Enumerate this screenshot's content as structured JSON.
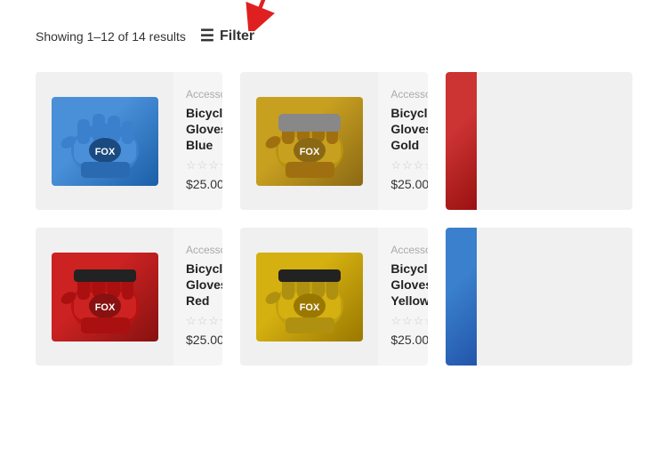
{
  "toolbar": {
    "showing_text": "Showing 1–12 of 14 results",
    "filter_label": "Filter",
    "filter_icon": "☰"
  },
  "products": [
    {
      "id": "p1",
      "category": "Accessories",
      "name": "Bicycle Gloves Blue",
      "price": "$25.00",
      "rating": 0,
      "color_class": "glove-blue",
      "emoji": "🧤"
    },
    {
      "id": "p2",
      "category": "Accessories",
      "name": "Bicycle Gloves Gold",
      "price": "$25.00",
      "rating": 0,
      "color_class": "glove-gold",
      "emoji": "🧤"
    },
    {
      "id": "p3",
      "category": "",
      "name": "",
      "price": "",
      "partial": true,
      "partial_color": "red"
    },
    {
      "id": "p4",
      "category": "Accessories",
      "name": "Bicycle Gloves Red",
      "price": "$25.00",
      "rating": 0,
      "color_class": "glove-red",
      "emoji": "🧤"
    },
    {
      "id": "p5",
      "category": "Accessories",
      "name": "Bicycle Gloves Yellow",
      "price": "$25.00",
      "rating": 0,
      "color_class": "glove-yellow",
      "emoji": "🧤"
    },
    {
      "id": "p6",
      "category": "",
      "name": "",
      "price": "",
      "partial": true,
      "partial_color": "blue"
    }
  ],
  "stars": [
    "☆",
    "☆",
    "☆",
    "☆",
    "☆"
  ]
}
